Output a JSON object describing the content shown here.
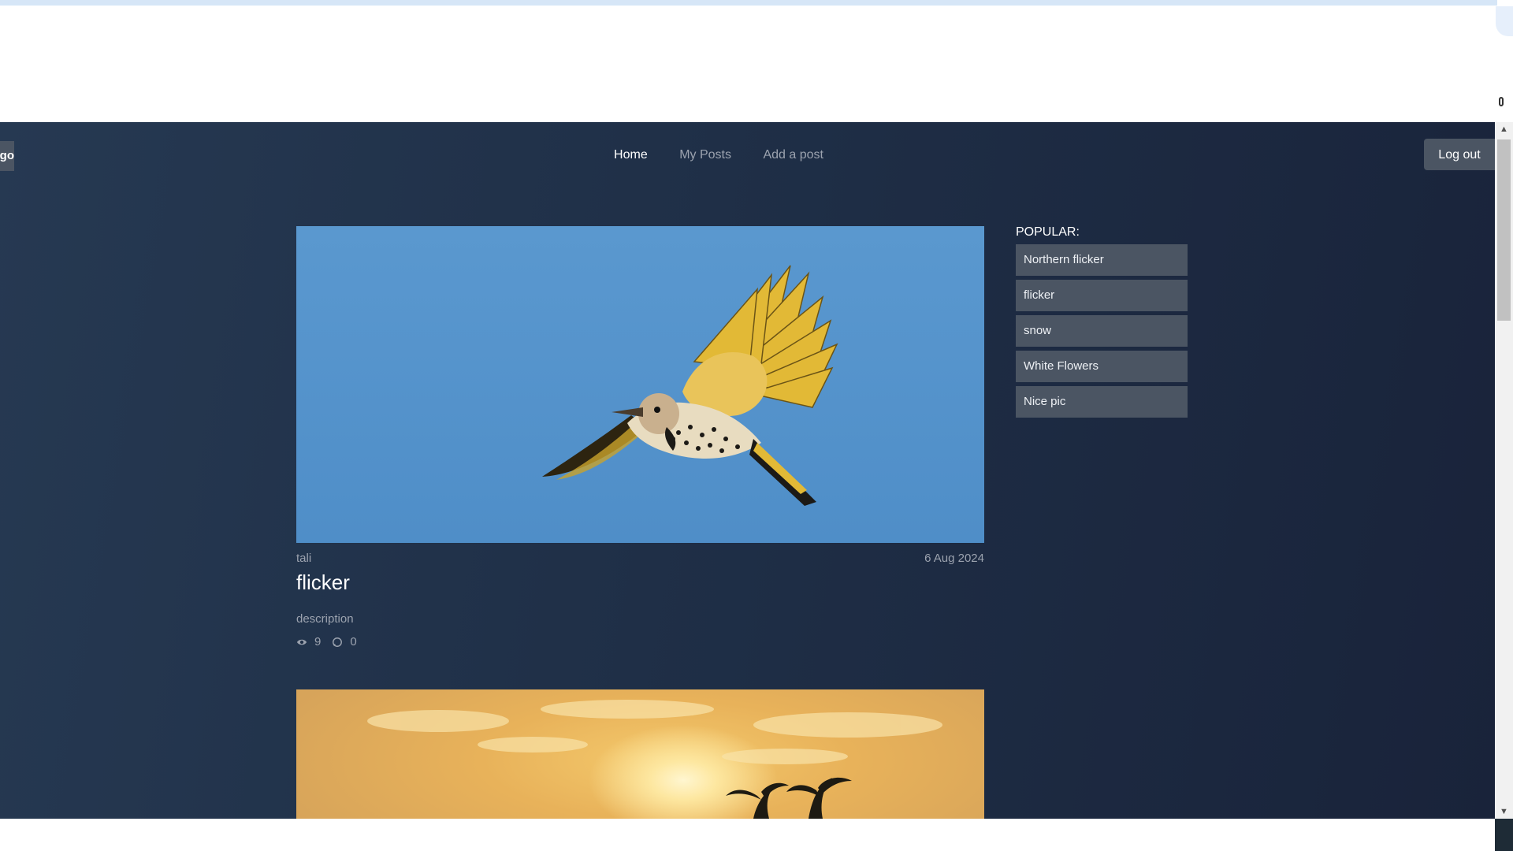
{
  "header": {
    "logo_label": "Logo",
    "nav": [
      {
        "label": "Home",
        "active": true
      },
      {
        "label": "My Posts",
        "active": false
      },
      {
        "label": "Add a post",
        "active": false
      }
    ],
    "logout_label": "Log out"
  },
  "posts": [
    {
      "author": "tali",
      "date": "6 Aug 2024",
      "title": "flicker",
      "description": "description",
      "views": "9",
      "comments": "0",
      "image": "flying-bird-photo"
    },
    {
      "image": "sunset-photo"
    }
  ],
  "popular": {
    "title": "POPULAR:",
    "items": [
      "Northern flicker",
      "flicker",
      "snow",
      "White Flowers",
      "Nice pic"
    ]
  },
  "colors": {
    "background": "#1f2f47",
    "button": "#4b5563",
    "nav_active": "#ffffff",
    "nav_inactive": "#9ca3af"
  },
  "icons": [
    "eye-icon",
    "comment-icon",
    "scroll-up-icon",
    "scroll-down-icon"
  ]
}
